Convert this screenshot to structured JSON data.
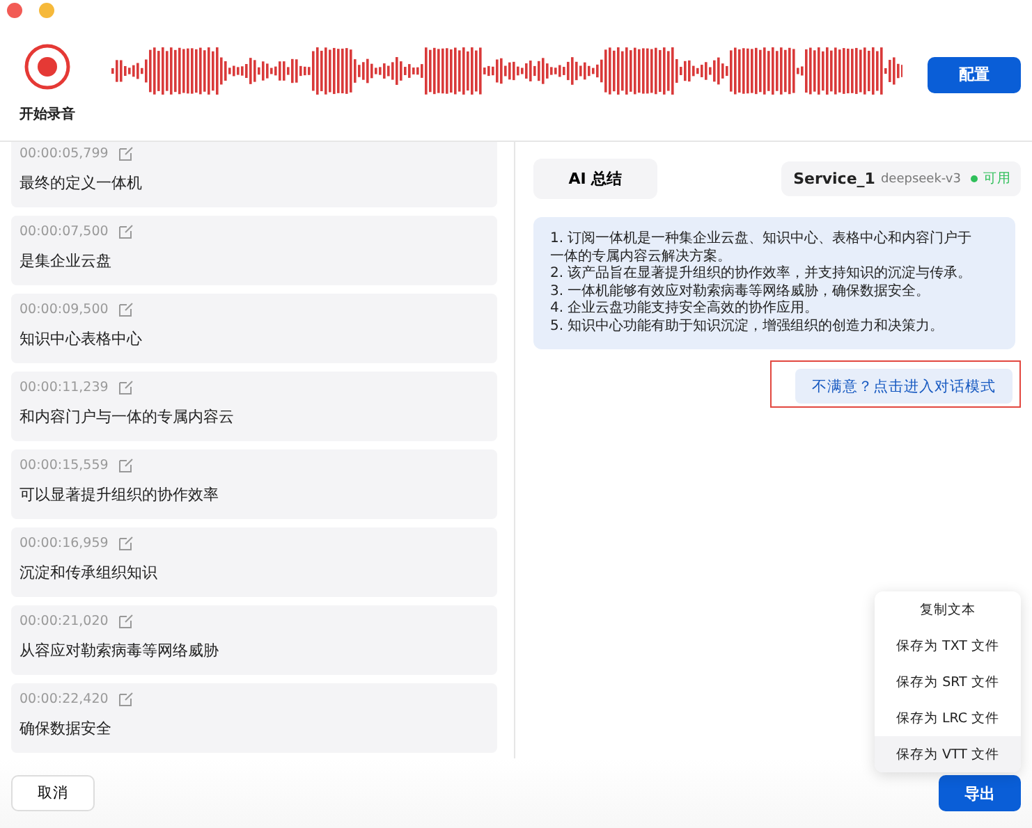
{
  "window": {
    "controls": [
      {
        "kind": "close"
      },
      {
        "kind": "minimize"
      }
    ]
  },
  "recorder": {
    "label": "开始录音",
    "recording": true
  },
  "config_button": "配置",
  "transcript": [
    {
      "time": "00:00:05,799",
      "text": "最终的定义一体机"
    },
    {
      "time": "00:00:07,500",
      "text": "是集企业云盘"
    },
    {
      "time": "00:00:09,500",
      "text": "知识中心表格中心"
    },
    {
      "time": "00:00:11,239",
      "text": "和内容门户与一体的专属内容云"
    },
    {
      "time": "00:00:15,559",
      "text": "可以显著提升组织的协作效率"
    },
    {
      "time": "00:00:16,959",
      "text": "沉淀和传承组织知识"
    },
    {
      "time": "00:00:21,020",
      "text": "从容应对勒索病毒等网络威胁"
    },
    {
      "time": "00:00:22,420",
      "text": "确保数据安全"
    }
  ],
  "summary": {
    "button": "AI 总结",
    "service": {
      "name": "Service_1",
      "model": "deepseek-v3",
      "status": "可用",
      "available": true
    },
    "lines": [
      "1. 订阅一体机是一种集企业云盘、知识中心、表格中心和内容门户于一体的专属内容云解决方案。",
      "2. 该产品旨在显著提升组织的协作效率，并支持知识的沉淀与传承。",
      "3. 一体机能够有效应对勒索病毒等网络威胁，确保数据安全。",
      "4. 企业云盘功能支持安全高效的协作应用。",
      "5. 知识中心功能有助于知识沉淀，增强组织的创造力和决策力。"
    ],
    "chat_link": {
      "label": "不满意？点击进入对话模式",
      "highlighted": true
    }
  },
  "export_menu": [
    {
      "label": "复制文本",
      "selected": false
    },
    {
      "label": "保存为 TXT 文件",
      "selected": false
    },
    {
      "label": "保存为 SRT 文件",
      "selected": false
    },
    {
      "label": "保存为 LRC 文件",
      "selected": false
    },
    {
      "label": "保存为 VTT 文件",
      "selected": true
    }
  ],
  "footer": {
    "cancel": "取消",
    "export": "导出"
  }
}
